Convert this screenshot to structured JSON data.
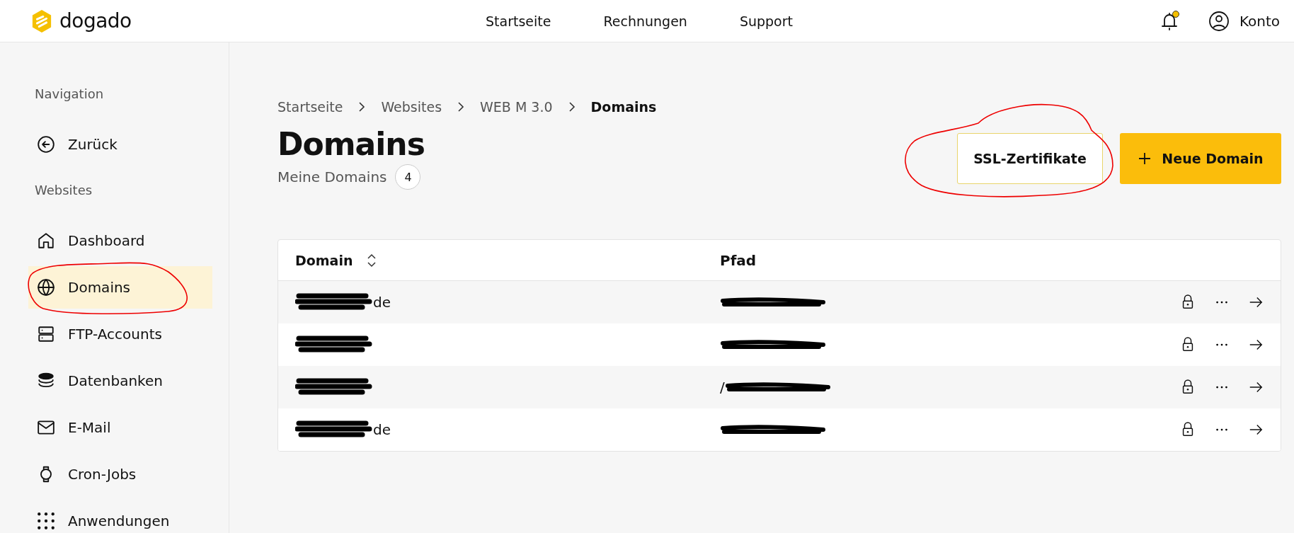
{
  "header": {
    "logo": "dogado",
    "nav": [
      {
        "label": "Startseite"
      },
      {
        "label": "Rechnungen"
      },
      {
        "label": "Support"
      }
    ],
    "notification_unread": true,
    "account": "Konto"
  },
  "sidebar": {
    "sections": [
      {
        "title": "Navigation",
        "items": [
          {
            "label": "Zurück",
            "selected": false
          }
        ]
      },
      {
        "title": "Websites",
        "items": [
          {
            "label": "Dashboard",
            "selected": false
          },
          {
            "label": "Domains",
            "selected": true,
            "annotated": true
          },
          {
            "label": "FTP-Accounts",
            "selected": false
          },
          {
            "label": "Datenbanken",
            "selected": false
          },
          {
            "label": "E-Mail",
            "selected": false
          },
          {
            "label": "Cron-Jobs",
            "selected": false
          },
          {
            "label": "Anwendungen",
            "selected": false
          }
        ]
      }
    ]
  },
  "breadcrumb": [
    {
      "label": "Startseite",
      "current": false
    },
    {
      "label": "Websites",
      "current": false
    },
    {
      "label": "WEB M 3.0",
      "current": false
    },
    {
      "label": "Domains",
      "current": true
    }
  ],
  "page": {
    "title": "Domains",
    "subtitle": "Meine Domains",
    "count": "4"
  },
  "buttons": [
    {
      "label": "SSL-Zertifikate",
      "kind": "secondary",
      "annotated": true
    },
    {
      "label": "Neue Domain",
      "kind": "primary",
      "annotated": false
    }
  ],
  "table": {
    "columns": [
      "Domain",
      "Pfad"
    ],
    "rows": [
      {
        "domain": "de"
      },
      {},
      {
        "path": "/"
      },
      {
        "domain": "de"
      }
    ]
  }
}
